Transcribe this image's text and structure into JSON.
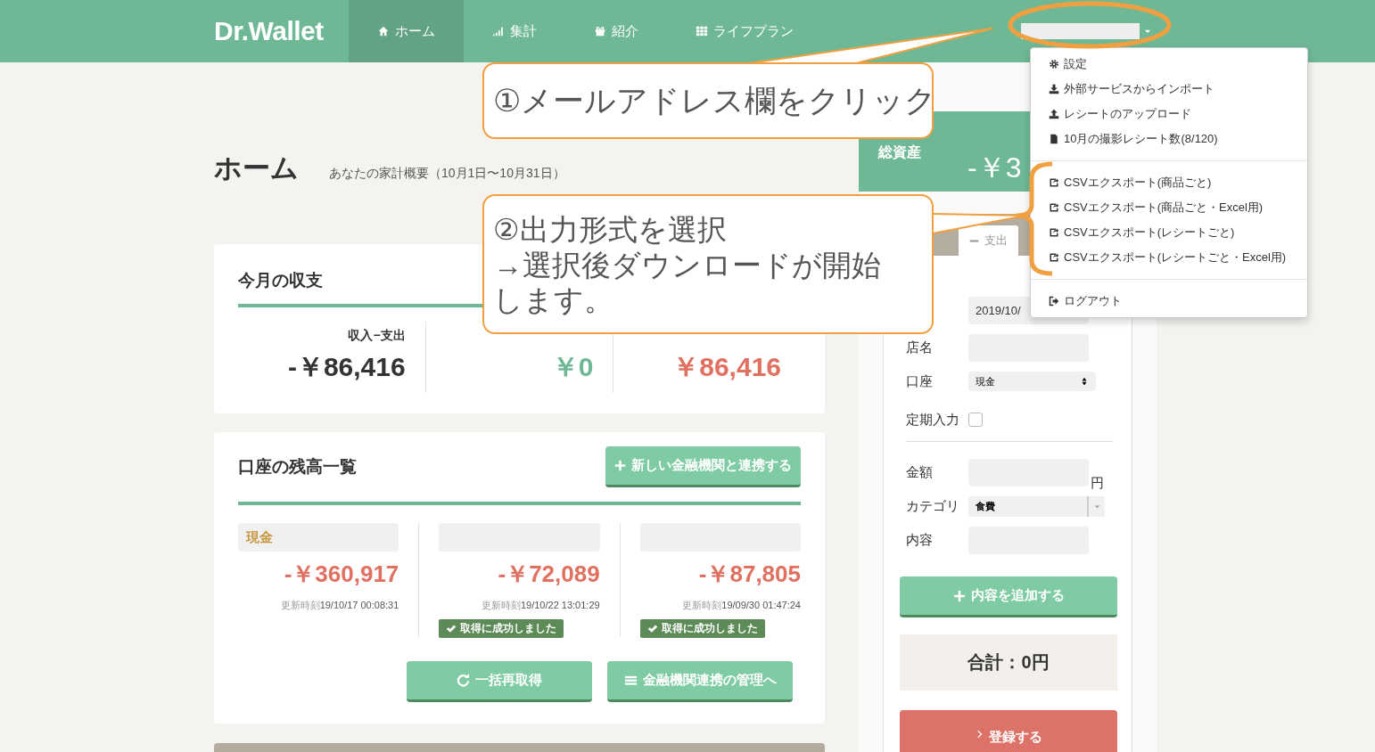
{
  "nav": {
    "logo": "Dr.Wallet",
    "items": [
      {
        "label": "ホーム",
        "selected": true
      },
      {
        "label": "集計",
        "selected": false
      },
      {
        "label": "紹介",
        "selected": false
      },
      {
        "label": "ライフプラン",
        "selected": false
      }
    ],
    "account_menu": {
      "expanded": true
    }
  },
  "page": {
    "title": "ホーム",
    "subtitle": "あなたの家計概要（10月1日〜10月31日）"
  },
  "monthly": {
    "title": "今月の収支",
    "cells": [
      {
        "kind": "net",
        "label": "収入−支出",
        "value": "-￥86,416"
      },
      {
        "kind": "income",
        "value": "￥0"
      },
      {
        "kind": "expense",
        "value": "￥86,416"
      }
    ]
  },
  "accounts": {
    "title": "口座の残高一覧",
    "add_button": "新しい金融機関と連携する",
    "items": [
      {
        "name": "現金",
        "balance": "-￥360,917",
        "updated_label": "更新時刻",
        "updated": "19/10/17 00:08:31"
      },
      {
        "balance": "-￥72,089",
        "updated_label": "更新時刻",
        "updated": "19/10/22 13:01:29",
        "status": "取得に成功しました"
      },
      {
        "balance": "-￥87,805",
        "updated_label": "更新時刻",
        "updated": "19/09/30 01:47:24",
        "status": "取得に成功しました"
      }
    ],
    "buttons": [
      {
        "label": "一括再取得"
      },
      {
        "label": "金融機関連携の管理へ"
      }
    ]
  },
  "total_assets": {
    "label": "総資産",
    "value": "-￥3"
  },
  "entry_form": {
    "tabs": [
      {
        "label": "支出",
        "selected": true
      }
    ],
    "date": "2019/10/",
    "fields": [
      {
        "kind": "text",
        "label": "店名"
      },
      {
        "kind": "select",
        "label": "口座",
        "value": "現金"
      },
      {
        "kind": "checkbox",
        "label": "定期入力",
        "checked": false
      },
      {
        "kind": "text",
        "label": "金額",
        "unit": "円"
      },
      {
        "kind": "combo",
        "label": "カテゴリ",
        "value": "食費"
      },
      {
        "kind": "text",
        "label": "内容"
      }
    ],
    "add_button": "内容を追加する",
    "total": "合計：0円",
    "submit_button": "登録する"
  },
  "account_dropdown": [
    [
      {
        "label": "設定"
      },
      {
        "label": "外部サービスからインポート"
      },
      {
        "label": "レシートのアップロード"
      },
      {
        "label": "10月の撮影レシート数(8/120)"
      }
    ],
    [
      {
        "label": "CSVエクスポート(商品ごと)"
      },
      {
        "label": "CSVエクスポート(商品ごと・Excel用)"
      },
      {
        "label": "CSVエクスポート(レシートごと)"
      },
      {
        "label": "CSVエクスポート(レシートごと・Excel用)"
      }
    ],
    [
      {
        "label": "ログアウト"
      }
    ]
  ],
  "callouts": [
    {
      "lines": [
        "①メールアドレス欄をクリック"
      ]
    },
    {
      "lines": [
        "②出力形式を選択",
        "→選択後ダウンロードが開始",
        "します。"
      ]
    }
  ]
}
